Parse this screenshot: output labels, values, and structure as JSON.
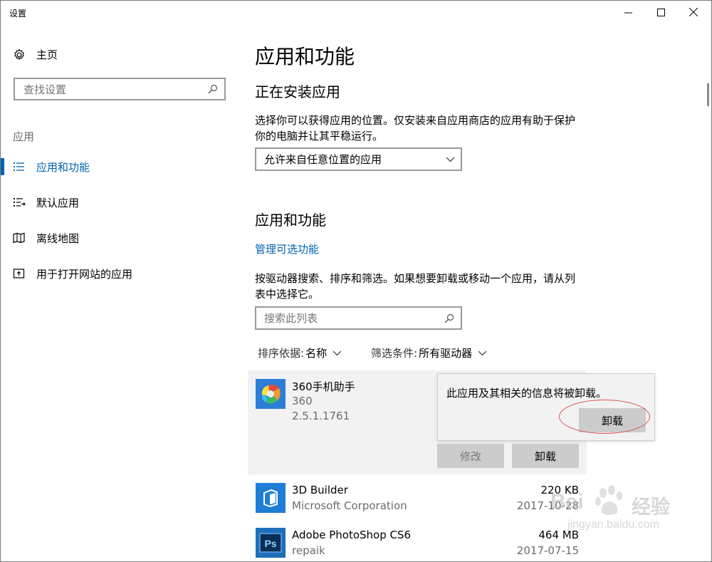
{
  "window": {
    "title": "设置"
  },
  "sidebar": {
    "home_label": "主页",
    "search_placeholder": "查找设置",
    "section_label": "应用",
    "items": [
      {
        "label": "应用和功能",
        "icon": "list-icon",
        "active": true
      },
      {
        "label": "默认应用",
        "icon": "default-apps-icon",
        "active": false
      },
      {
        "label": "离线地图",
        "icon": "map-icon",
        "active": false
      },
      {
        "label": "用于打开网站的应用",
        "icon": "open-website-icon",
        "active": false
      }
    ]
  },
  "main": {
    "title": "应用和功能",
    "install_heading": "正在安装应用",
    "install_desc": "选择你可以获得应用的位置。仅安装来自应用商店的应用有助于保护你的电脑并让其平稳运行。",
    "install_dropdown_value": "允许来自任意位置的应用",
    "apps_heading": "应用和功能",
    "manage_link": "管理可选功能",
    "apps_desc": "按驱动器搜索、排序和筛选。如果想要卸载或移动一个应用，请从列表中选择它。",
    "apps_search_placeholder": "搜索此列表",
    "sort_key": "排序依据:",
    "sort_value": "名称",
    "filter_key": "筛选条件:",
    "filter_value": "所有驱动器",
    "apps": [
      {
        "name": "360手机助手",
        "publisher": "360",
        "version": "2.5.1.1761",
        "size": "",
        "date": ""
      },
      {
        "name": "3D Builder",
        "publisher": "Microsoft Corporation",
        "version": "",
        "size": "220 KB",
        "date": "2017-10-28"
      },
      {
        "name": "Adobe PhotoShop CS6",
        "publisher": "repaik",
        "version": "",
        "size": "464 MB",
        "date": "2017-07-15"
      }
    ],
    "modify_button": "修改",
    "uninstall_button": "卸载",
    "popup": {
      "message": "此应用及其相关的信息将被卸载。",
      "confirm_button": "卸载"
    }
  },
  "watermark": {
    "brand": "Bai",
    "brand_cn": "经验",
    "url": "jingyan.baidu.com"
  },
  "colors": {
    "accent": "#0063b1",
    "annotation": "#e05050"
  }
}
